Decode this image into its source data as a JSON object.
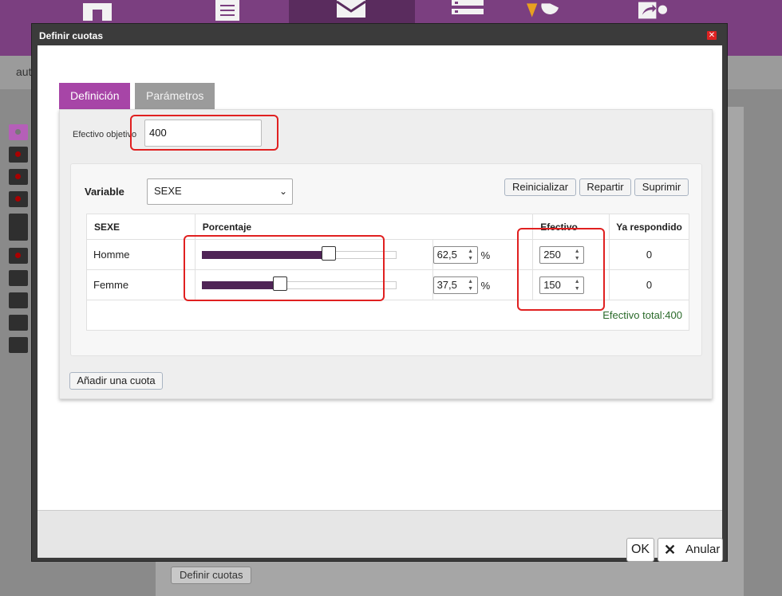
{
  "background": {
    "subbar_text": "aut",
    "define_button": "Definir cuotas"
  },
  "dialog": {
    "title": "Definir cuotas",
    "close_icon": "close-icon",
    "tabs": [
      {
        "label": "Definición",
        "active": true
      },
      {
        "label": "Parámetros",
        "active": false
      }
    ],
    "target_label": "Efectivo objetivo",
    "target_value": "400",
    "variable_label": "Variable",
    "variable_selected": "SEXE",
    "buttons": {
      "reset": "Reinicializar",
      "distribute": "Repartir",
      "delete": "Suprimir",
      "add_quota": "Añadir una cuota",
      "ok": "OK",
      "cancel": "Anular"
    },
    "table": {
      "headers": [
        "SEXE",
        "Porcentaje",
        "Efectivo",
        "Ya respondido"
      ],
      "rows": [
        {
          "label": "Homme",
          "percent": 62.5,
          "percent_text": "62,5",
          "unit": "%",
          "effective": "250",
          "answered": "0"
        },
        {
          "label": "Femme",
          "percent": 37.5,
          "percent_text": "37,5",
          "unit": "%",
          "effective": "150",
          "answered": "0"
        }
      ],
      "total": "Efectivo total:400"
    }
  },
  "colors": {
    "accent": "#a745a7",
    "topbar": "#7b3f80",
    "slider_fill": "#4f2456",
    "annotation": "#e02020"
  }
}
